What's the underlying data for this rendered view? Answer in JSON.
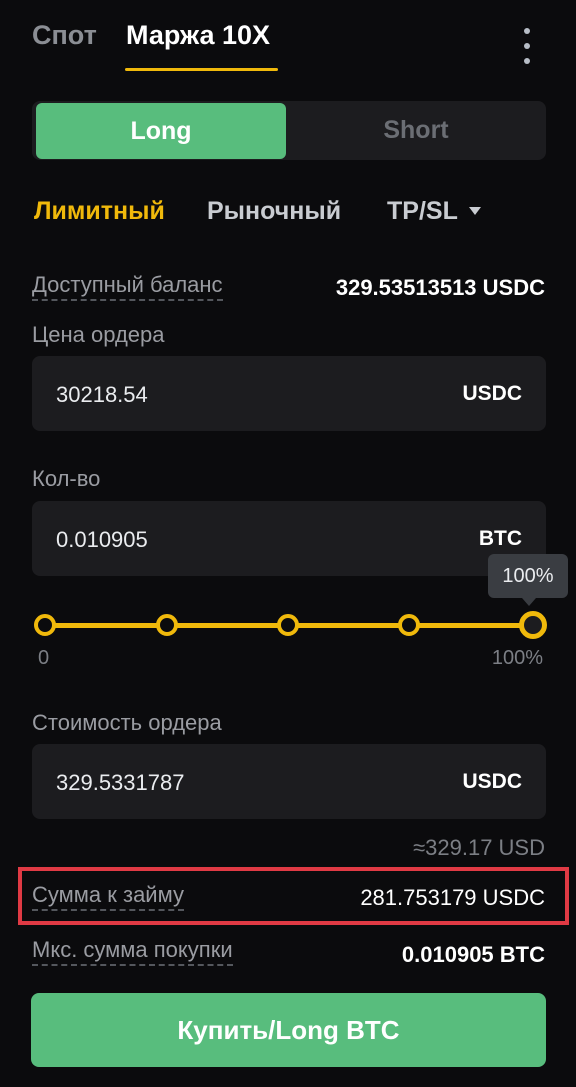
{
  "tabs": {
    "spot": "Спот",
    "margin": "Маржа 10X"
  },
  "side_toggle": {
    "long": "Long",
    "short": "Short"
  },
  "order_types": {
    "limit": "Лимитный",
    "market": "Рыночный",
    "tpsl": "TP/SL"
  },
  "balance": {
    "label": "Доступный баланс",
    "value": "329.53513513 USDC"
  },
  "price": {
    "label": "Цена ордера",
    "value": "30218.54",
    "unit": "USDC"
  },
  "quantity": {
    "label": "Кол-во",
    "value": "0.010905",
    "unit": "BTC"
  },
  "slider": {
    "tooltip": "100%",
    "min_label": "0",
    "max_label": "100%",
    "percent": 100,
    "steps": [
      0,
      25,
      50,
      75,
      100
    ]
  },
  "order_value": {
    "label": "Стоимость ордера",
    "value": "329.5331787",
    "unit": "USDC",
    "approx": "≈329.17 USD"
  },
  "borrow": {
    "label": "Сумма к займу",
    "value": "281.753179 USDC"
  },
  "max_buy": {
    "label": "Мкс. сумма покупки",
    "value": "0.010905 BTC"
  },
  "buy_button": {
    "label": "Купить/Long BTC"
  },
  "colors": {
    "accent": "#f0b90b",
    "buy": "#58bd7d",
    "highlight": "#e03a44"
  },
  "icons": {
    "menu": "kebab-menu-icon",
    "dropdown": "triangle-down-icon"
  }
}
